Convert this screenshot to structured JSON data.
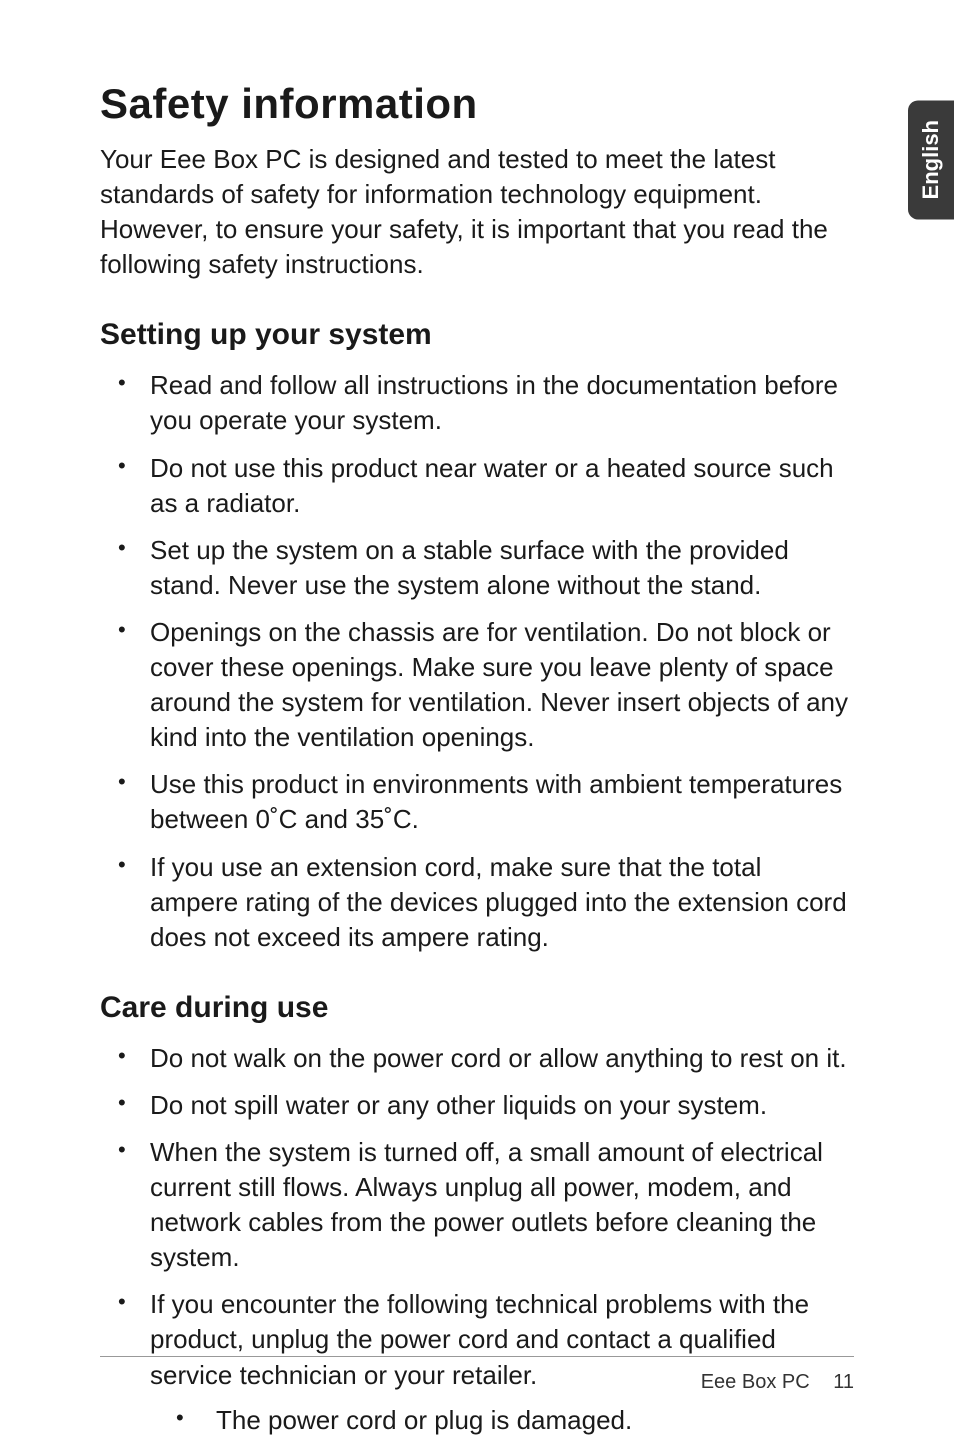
{
  "sideTab": "English",
  "title": "Safety information",
  "intro": "Your Eee Box PC is designed and tested to meet the latest standards of safety for information technology equipment. However, to ensure your safety, it is important that you read the following safety instructions.",
  "section1": {
    "heading": "Setting up your system",
    "items": [
      "Read and follow all instructions in the documentation before you operate your system.",
      "Do not use this product near water or a heated source such as a radiator.",
      "Set up the system on a stable surface with the provided stand. Never use the system alone without the stand.",
      "Openings on the chassis are for ventilation. Do not block or cover these openings. Make sure you leave plenty of space around the system for ventilation. Never insert objects of any kind into the ventilation openings.",
      "Use this product in environments with ambient temperatures between 0˚C and 35˚C.",
      "If you use an extension cord, make sure that the total ampere rating of the devices plugged into the extension cord does not exceed its ampere rating."
    ]
  },
  "section2": {
    "heading": "Care during use",
    "items": [
      "Do not walk on the power cord or allow anything to rest on it.",
      "Do not spill water or any other liquids on your system.",
      "When the system is turned off, a small amount of electrical current still flows. Always unplug all power, modem, and network cables from the power outlets before cleaning the system.",
      "If you encounter the following technical problems with the product, unplug the power cord and contact a qualified service technician or your retailer."
    ],
    "subitems": [
      "The power cord or plug is damaged."
    ]
  },
  "footer": {
    "label": "Eee Box PC",
    "page": "11"
  }
}
